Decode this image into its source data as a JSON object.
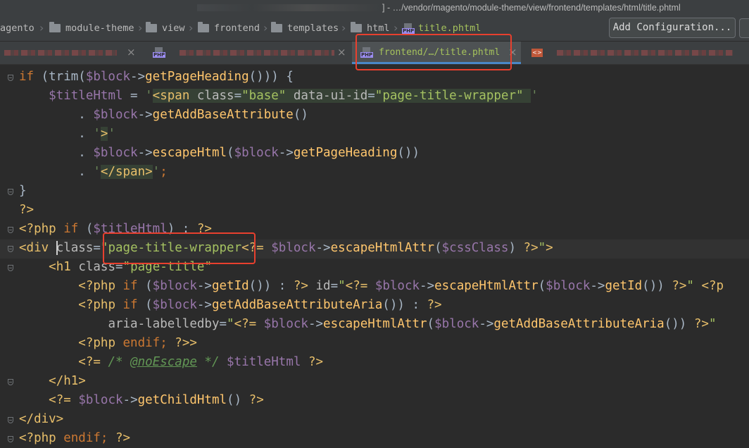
{
  "titlebar": {
    "path": "] - …/vendor/magento/module-theme/view/frontend/templates/html/title.phtml"
  },
  "breadcrumb": {
    "items": [
      "agento",
      "module-theme",
      "view",
      "frontend",
      "templates",
      "html",
      "title.phtml"
    ],
    "add_config": "Add Configuration..."
  },
  "tabs": {
    "active_label": "frontend/…/title.phtml"
  },
  "code": {
    "lines": [
      [
        [
          "k",
          "if "
        ],
        [
          "p",
          "(trim("
        ],
        [
          "v",
          "$block"
        ],
        [
          "p",
          "->"
        ],
        [
          "f",
          "getPageHeading"
        ],
        [
          "p",
          "())) {"
        ]
      ],
      [
        [
          "p",
          "    "
        ],
        [
          "v",
          "$titleHtml"
        ],
        [
          "p",
          " = "
        ],
        [
          "s",
          "'"
        ],
        [
          "ti",
          "<span "
        ],
        [
          "ai",
          "class"
        ],
        [
          "ii",
          "="
        ],
        [
          "vi",
          "\"base\" "
        ],
        [
          "ai",
          "data-ui-id"
        ],
        [
          "ii",
          "="
        ],
        [
          "vi",
          "\"page-title-wrapper\" "
        ],
        [
          "s",
          "'"
        ]
      ],
      [
        [
          "p",
          "        . "
        ],
        [
          "v",
          "$block"
        ],
        [
          "p",
          "->"
        ],
        [
          "f",
          "getAddBaseAttribute"
        ],
        [
          "p",
          "()"
        ]
      ],
      [
        [
          "p",
          "        . "
        ],
        [
          "s",
          "'"
        ],
        [
          "ti",
          ">"
        ],
        [
          "s",
          "'"
        ]
      ],
      [
        [
          "p",
          "        . "
        ],
        [
          "v",
          "$block"
        ],
        [
          "p",
          "->"
        ],
        [
          "f",
          "escapeHtml"
        ],
        [
          "p",
          "("
        ],
        [
          "v",
          "$block"
        ],
        [
          "p",
          "->"
        ],
        [
          "f",
          "getPageHeading"
        ],
        [
          "p",
          "())"
        ]
      ],
      [
        [
          "p",
          "        . "
        ],
        [
          "s",
          "'"
        ],
        [
          "ti",
          "</span>"
        ],
        [
          "s",
          "'"
        ],
        [
          "k",
          ";"
        ]
      ],
      [
        [
          "p",
          "}"
        ]
      ],
      [
        [
          "t",
          "?>"
        ]
      ],
      [
        [
          "t",
          "<?php "
        ],
        [
          "k",
          "if "
        ],
        [
          "p",
          "("
        ],
        [
          "v",
          "$titleHtml"
        ],
        [
          "p",
          ") : "
        ],
        [
          "t",
          "?>"
        ]
      ],
      [
        [
          "t",
          "<div "
        ],
        [
          "caret",
          ""
        ],
        [
          "a",
          "class"
        ],
        [
          "p",
          "="
        ],
        [
          "av",
          "\"page-title-wrapper"
        ],
        [
          "t",
          "<?= "
        ],
        [
          "v",
          "$block"
        ],
        [
          "p",
          "->"
        ],
        [
          "f",
          "escapeHtmlAttr"
        ],
        [
          "p",
          "("
        ],
        [
          "v",
          "$cssClass"
        ],
        [
          "p",
          ") "
        ],
        [
          "t",
          "?>"
        ],
        [
          "av",
          "\""
        ],
        [
          "t",
          ">"
        ]
      ],
      [
        [
          "p",
          "    "
        ],
        [
          "t",
          "<h1 "
        ],
        [
          "a",
          "class"
        ],
        [
          "p",
          "="
        ],
        [
          "av",
          "\"page-title\""
        ]
      ],
      [
        [
          "p",
          "        "
        ],
        [
          "t",
          "<?php "
        ],
        [
          "k",
          "if "
        ],
        [
          "p",
          "("
        ],
        [
          "v",
          "$block"
        ],
        [
          "p",
          "->"
        ],
        [
          "f",
          "getId"
        ],
        [
          "p",
          "()) : "
        ],
        [
          "t",
          "?> "
        ],
        [
          "a",
          "id"
        ],
        [
          "p",
          "="
        ],
        [
          "av",
          "\""
        ],
        [
          "t",
          "<?= "
        ],
        [
          "v",
          "$block"
        ],
        [
          "p",
          "->"
        ],
        [
          "f",
          "escapeHtmlAttr"
        ],
        [
          "p",
          "("
        ],
        [
          "v",
          "$block"
        ],
        [
          "p",
          "->"
        ],
        [
          "f",
          "getId"
        ],
        [
          "p",
          "()) "
        ],
        [
          "t",
          "?>"
        ],
        [
          "av",
          "\" "
        ],
        [
          "t",
          "<?p"
        ]
      ],
      [
        [
          "p",
          "        "
        ],
        [
          "t",
          "<?php "
        ],
        [
          "k",
          "if "
        ],
        [
          "p",
          "("
        ],
        [
          "v",
          "$block"
        ],
        [
          "p",
          "->"
        ],
        [
          "f",
          "getAddBaseAttributeAria"
        ],
        [
          "p",
          "()) : "
        ],
        [
          "t",
          "?>"
        ]
      ],
      [
        [
          "p",
          "            "
        ],
        [
          "a",
          "aria-labelledby"
        ],
        [
          "p",
          "="
        ],
        [
          "av",
          "\""
        ],
        [
          "t",
          "<?= "
        ],
        [
          "v",
          "$block"
        ],
        [
          "p",
          "->"
        ],
        [
          "f",
          "escapeHtmlAttr"
        ],
        [
          "p",
          "("
        ],
        [
          "v",
          "$block"
        ],
        [
          "p",
          "->"
        ],
        [
          "f",
          "getAddBaseAttributeAria"
        ],
        [
          "p",
          "()) "
        ],
        [
          "t",
          "?>"
        ],
        [
          "av",
          "\""
        ]
      ],
      [
        [
          "p",
          "        "
        ],
        [
          "t",
          "<?php "
        ],
        [
          "k",
          "endif; "
        ],
        [
          "t",
          "?>>"
        ]
      ],
      [
        [
          "p",
          "        "
        ],
        [
          "t",
          "<?= "
        ],
        [
          "c",
          "/* "
        ],
        [
          "ct",
          "@noEscape"
        ],
        [
          "c",
          " */ "
        ],
        [
          "v",
          "$titleHtml"
        ],
        [
          "p",
          " "
        ],
        [
          "t",
          "?>"
        ]
      ],
      [
        [
          "p",
          "    "
        ],
        [
          "t",
          "</h1>"
        ]
      ],
      [
        [
          "p",
          "    "
        ],
        [
          "t",
          "<?= "
        ],
        [
          "v",
          "$block"
        ],
        [
          "p",
          "->"
        ],
        [
          "f",
          "getChildHtml"
        ],
        [
          "p",
          "() "
        ],
        [
          "t",
          "?>"
        ]
      ],
      [
        [
          "t",
          "</div>"
        ]
      ],
      [
        [
          "t",
          "<?php "
        ],
        [
          "k",
          "endif; "
        ],
        [
          "t",
          "?>"
        ]
      ]
    ]
  }
}
